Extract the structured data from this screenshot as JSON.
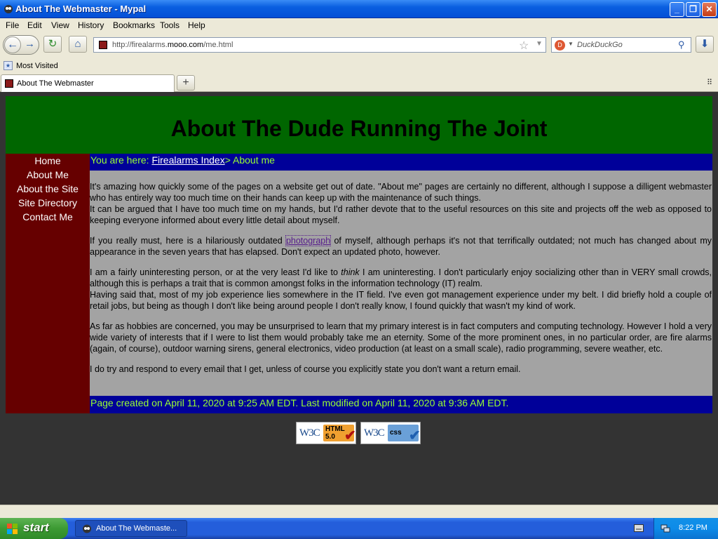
{
  "window": {
    "title": "About The Webmaster - Mypal"
  },
  "menu": [
    "File",
    "Edit",
    "View",
    "History",
    "Bookmarks",
    "Tools",
    "Help"
  ],
  "navbar": {
    "url_prefix": "http://firealarms.",
    "url_domain": "mooo.com",
    "url_suffix": "/me.html",
    "search_placeholder": "DuckDuckGo"
  },
  "bookmarks": {
    "most_visited": "Most Visited"
  },
  "tabs": [
    {
      "title": "About The Webmaster"
    }
  ],
  "page": {
    "heading": "About The Dude Running The Joint",
    "sidebar": [
      "Home",
      "About Me",
      "About the Site",
      "Site Directory",
      "Contact Me"
    ],
    "breadcrumb": {
      "prefix": "You are here: ",
      "link": "Firealarms Index",
      "suffix": "> About me"
    },
    "paragraphs": {
      "p1": "It's amazing how quickly some of the pages on a website get out of date. \"About me\" pages are certainly no different, although I suppose a dilligent webmaster who has entirely way too much time on their hands can keep up with the maintenance of such things.",
      "p1b": "It can be argued that I have too much time on my hands, but I'd rather devote that to the useful resources on this site and projects off the web as opposed to keeping everyone informed about every little detail about myself.",
      "p2_before": "If you really must, here is a hilariously outdated ",
      "p2_link": "photograph",
      "p2_after": " of myself, although perhaps it's not that terrifically outdated; not much has changed about my appearance in the seven years that has elapsed. Don't expect an updated photo, however.",
      "p3_before": "I am a fairly uninteresting person, or at the very least I'd like to ",
      "p3_em": "think",
      "p3_after": " I am uninteresting. I don't particularly enjoy socializing other than in VERY small crowds, although this is perhaps a trait that is common amongst folks in the information technology (IT) realm.",
      "p3b": "Having said that, most of my job experience lies somewhere in the IT field. I've even got management experience under my belt. I did briefly hold a couple of retail jobs, but being as though I don't like being around people I don't really know, I found quickly that wasn't my kind of work.",
      "p4": "As far as hobbies are concerned, you may be unsurprised to learn that my primary interest is in fact computers and computing technology. However I hold a very wide variety of interests that if I were to list them would probably take me an eternity. Some of the more prominent ones, in no particular order, are fire alarms (again, of course), outdoor warning sirens, general electronics, video production (at least on a small scale), radio programming, severe weather, etc.",
      "p5": "I do try and respond to every email that I get, unless of course you explicitly state you don't want a return email."
    },
    "footer": "Page created on April 11, 2020 at 9:25 AM EDT. Last modified on April 11, 2020 at 9:36 AM EDT.",
    "badges": {
      "w3c": "W3C",
      "html_label": "HTML",
      "html_version": "5.0",
      "css_label": "css"
    }
  },
  "taskbar": {
    "start": "start",
    "task_label": "About The Webmaste...",
    "clock": "8:22 PM"
  },
  "colors": {
    "header_bg": "#006600",
    "sidebar_bg": "#660000",
    "breadcrumb_bg": "#000099",
    "accent_text": "#99ff33",
    "content_bg": "#a3a3a3",
    "page_bg": "#333333"
  }
}
